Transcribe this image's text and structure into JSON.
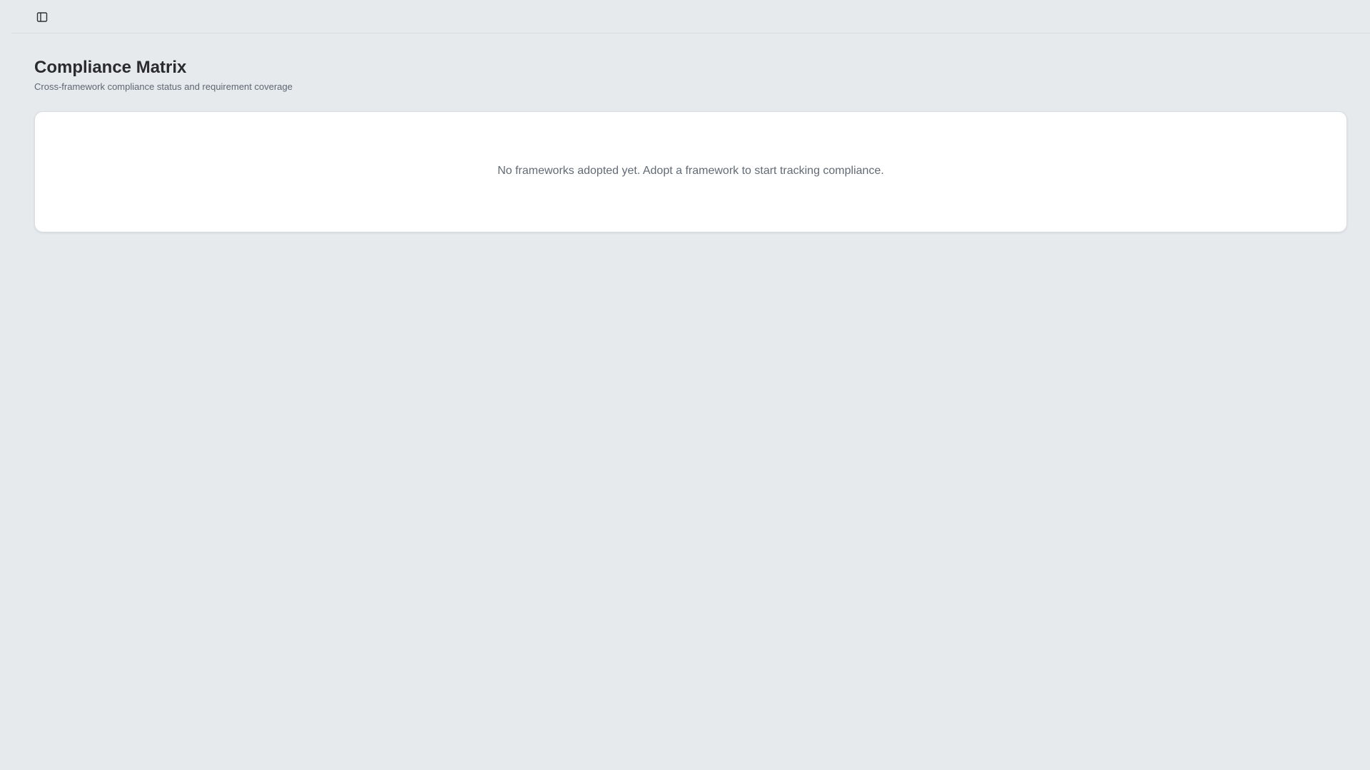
{
  "toolbar": {
    "sidebar_toggle_icon": "sidebar-panel-icon"
  },
  "header": {
    "title": "Compliance Matrix",
    "subtitle": "Cross-framework compliance status and requirement coverage"
  },
  "main": {
    "empty_message": "No frameworks adopted yet. Adopt a framework to start tracking compliance."
  },
  "colors": {
    "background": "#e6eaed",
    "card": "#ffffff",
    "title": "#2b2b2e",
    "muted_text": "#626a75"
  }
}
